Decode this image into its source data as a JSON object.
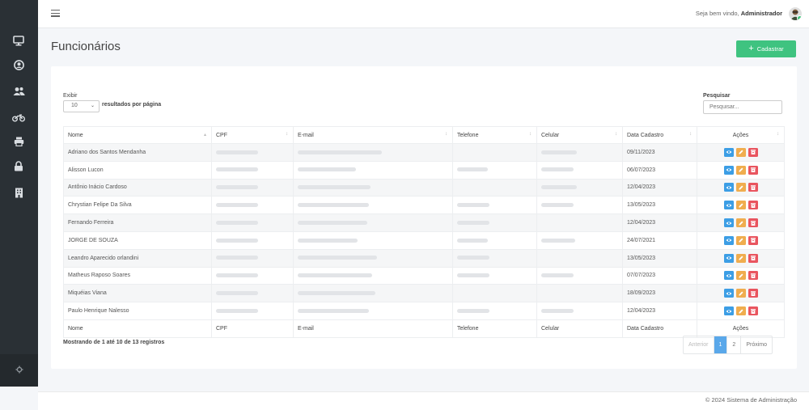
{
  "header": {
    "welcome_prefix": "Seja bem vindo,",
    "user_name": "Administrador"
  },
  "sidebar": {
    "items": [
      {
        "icon": "monitor-icon"
      },
      {
        "icon": "user-circle-icon"
      },
      {
        "icon": "users-icon"
      },
      {
        "icon": "motorcycle-icon"
      },
      {
        "icon": "printer-icon"
      },
      {
        "icon": "lock-icon"
      },
      {
        "icon": "building-icon"
      }
    ],
    "bottom_icon": "gear-icon"
  },
  "page": {
    "title": "Funcionários",
    "add_button": "Cadastrar"
  },
  "table_controls": {
    "length_label": "Exibir",
    "length_value": "10",
    "length_suffix": "resultados por página",
    "search_label": "Pesquisar",
    "search_placeholder": "Pesquisar..."
  },
  "table": {
    "columns": [
      "Nome",
      "CPF",
      "E-mail",
      "Telefone",
      "Celular",
      "Data Cadastro",
      "Ações"
    ],
    "rows": [
      {
        "nome": "Adriano dos Santos Mendanha",
        "data": "09/11/2023"
      },
      {
        "nome": "Alisson Lucon",
        "data": "06/07/2023"
      },
      {
        "nome": "Antônio Inácio Cardoso",
        "data": "12/04/2023"
      },
      {
        "nome": "Chrystian Felipe Da Silva",
        "data": "13/05/2023"
      },
      {
        "nome": "Fernando Ferreira",
        "data": "12/04/2023"
      },
      {
        "nome": "JORGE DE SOUZA",
        "data": "24/07/2021"
      },
      {
        "nome": "Leandro Aparecido orlandini",
        "data": "13/05/2023"
      },
      {
        "nome": "Matheus Raposo Soares",
        "data": "07/07/2023"
      },
      {
        "nome": "Miquéias Viana",
        "data": "18/09/2023"
      },
      {
        "nome": "Paulo Henrique Nalesso",
        "data": "12/04/2023"
      }
    ]
  },
  "pagination": {
    "info": "Mostrando de 1 até 10 de 13 registros",
    "previous": "Anterior",
    "pages": [
      "1",
      "2"
    ],
    "next": "Próximo",
    "active_page": "1"
  },
  "footer": {
    "text": "© 2024 Sistema de Administração"
  },
  "colors": {
    "sidebar": "#2a3035",
    "primary_green": "#3fc380",
    "view": "#3c9ee5",
    "edit": "#f0ad4e",
    "delete": "#e9555f",
    "active_page": "#5aa8ea"
  }
}
